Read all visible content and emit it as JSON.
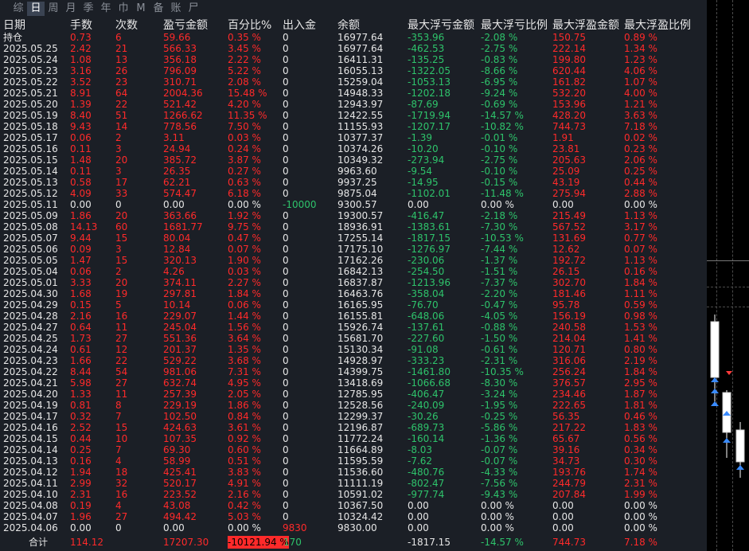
{
  "tabs": [
    "综",
    "日",
    "周",
    "月",
    "季",
    "年",
    "巾",
    "M",
    "备",
    "账",
    "尸"
  ],
  "active_tab": 1,
  "header": [
    "日期",
    "手数",
    "次数",
    "盈亏金额",
    "百分比%",
    "出入金",
    "余额",
    "最大浮亏金额",
    "最大浮亏比例",
    "最大浮盈金额",
    "最大浮盈比例"
  ],
  "rows": [
    [
      "持仓",
      "0.73",
      "6",
      "59.66",
      "0.35 %",
      "0",
      "16977.64",
      "-353.96",
      "-2.08 %",
      "150.75",
      "0.89 %"
    ],
    [
      "2025.05.25",
      "2.42",
      "21",
      "566.33",
      "3.45 %",
      "0",
      "16977.64",
      "-462.53",
      "-2.75 %",
      "222.14",
      "1.34 %"
    ],
    [
      "2025.05.24",
      "1.08",
      "13",
      "356.18",
      "2.22 %",
      "0",
      "16411.31",
      "-135.25",
      "-0.83 %",
      "199.80",
      "1.23 %"
    ],
    [
      "2025.05.23",
      "3.16",
      "26",
      "796.09",
      "5.22 %",
      "0",
      "16055.13",
      "-1322.05",
      "-8.66 %",
      "620.44",
      "4.06 %"
    ],
    [
      "2025.05.22",
      "3.52",
      "23",
      "310.71",
      "2.08 %",
      "0",
      "15259.04",
      "-1053.13",
      "-6.95 %",
      "161.82",
      "1.07 %"
    ],
    [
      "2025.05.21",
      "8.91",
      "64",
      "2004.36",
      "15.48 %",
      "0",
      "14948.33",
      "-1202.18",
      "-9.24 %",
      "532.20",
      "4.00 %"
    ],
    [
      "2025.05.20",
      "1.39",
      "22",
      "521.42",
      "4.20 %",
      "0",
      "12943.97",
      "-87.69",
      "-0.69 %",
      "153.96",
      "1.21 %"
    ],
    [
      "2025.05.19",
      "8.40",
      "51",
      "1266.62",
      "11.35 %",
      "0",
      "12422.55",
      "-1719.94",
      "-14.57 %",
      "428.20",
      "3.63 %"
    ],
    [
      "2025.05.18",
      "9.43",
      "14",
      "778.56",
      "7.50 %",
      "0",
      "11155.93",
      "-1207.17",
      "-10.82 %",
      "744.73",
      "7.18 %"
    ],
    [
      "2025.05.17",
      "0.06",
      "2",
      "3.11",
      "0.03 %",
      "0",
      "10377.37",
      "-1.39",
      "-0.01 %",
      "1.91",
      "0.02 %"
    ],
    [
      "2025.05.16",
      "0.11",
      "3",
      "24.94",
      "0.24 %",
      "0",
      "10374.26",
      "-10.20",
      "-0.10 %",
      "23.81",
      "0.23 %"
    ],
    [
      "2025.05.15",
      "1.48",
      "20",
      "385.72",
      "3.87 %",
      "0",
      "10349.32",
      "-273.94",
      "-2.75 %",
      "205.63",
      "2.06 %"
    ],
    [
      "2025.05.14",
      "0.11",
      "3",
      "26.35",
      "0.27 %",
      "0",
      "9963.60",
      "-9.54",
      "-0.10 %",
      "25.09",
      "0.25 %"
    ],
    [
      "2025.05.13",
      "0.58",
      "17",
      "62.21",
      "0.63 %",
      "0",
      "9937.25",
      "-14.95",
      "-0.15 %",
      "43.19",
      "0.44 %"
    ],
    [
      "2025.05.12",
      "4.09",
      "33",
      "574.47",
      "6.18 %",
      "0",
      "9875.04",
      "-1102.01",
      "-11.48 %",
      "275.94",
      "2.88 %"
    ],
    [
      "2025.05.11",
      "0.00",
      "0",
      "0.00",
      "0.00 %",
      "-10000",
      "9300.57",
      "0.00",
      "0.00 %",
      "0.00",
      "0.00 %"
    ],
    [
      "2025.05.09",
      "1.86",
      "20",
      "363.66",
      "1.92 %",
      "0",
      "19300.57",
      "-416.47",
      "-2.18 %",
      "215.49",
      "1.13 %"
    ],
    [
      "2025.05.08",
      "14.13",
      "60",
      "1681.77",
      "9.75 %",
      "0",
      "18936.91",
      "-1383.61",
      "-7.30 %",
      "567.52",
      "3.17 %"
    ],
    [
      "2025.05.07",
      "9.44",
      "15",
      "80.04",
      "0.47 %",
      "0",
      "17255.14",
      "-1817.15",
      "-10.53 %",
      "131.69",
      "0.77 %"
    ],
    [
      "2025.05.06",
      "0.09",
      "3",
      "12.84",
      "0.07 %",
      "0",
      "17175.10",
      "-1276.97",
      "-7.44 %",
      "12.62",
      "0.07 %"
    ],
    [
      "2025.05.05",
      "1.47",
      "15",
      "320.13",
      "1.90 %",
      "0",
      "17162.26",
      "-230.06",
      "-1.37 %",
      "192.72",
      "1.13 %"
    ],
    [
      "2025.05.04",
      "0.06",
      "2",
      "4.26",
      "0.03 %",
      "0",
      "16842.13",
      "-254.50",
      "-1.51 %",
      "26.15",
      "0.16 %"
    ],
    [
      "2025.05.01",
      "3.33",
      "20",
      "374.11",
      "2.27 %",
      "0",
      "16837.87",
      "-1213.96",
      "-7.37 %",
      "302.70",
      "1.84 %"
    ],
    [
      "2025.04.30",
      "1.68",
      "19",
      "297.81",
      "1.84 %",
      "0",
      "16463.76",
      "-358.04",
      "-2.20 %",
      "181.46",
      "1.11 %"
    ],
    [
      "2025.04.29",
      "0.15",
      "5",
      "10.14",
      "0.06 %",
      "0",
      "16165.95",
      "-76.70",
      "-0.47 %",
      "95.78",
      "0.59 %"
    ],
    [
      "2025.04.28",
      "2.16",
      "16",
      "229.07",
      "1.44 %",
      "0",
      "16155.81",
      "-648.06",
      "-4.05 %",
      "156.19",
      "0.98 %"
    ],
    [
      "2025.04.27",
      "0.64",
      "11",
      "245.04",
      "1.56 %",
      "0",
      "15926.74",
      "-137.61",
      "-0.88 %",
      "240.58",
      "1.53 %"
    ],
    [
      "2025.04.25",
      "1.73",
      "27",
      "551.36",
      "3.64 %",
      "0",
      "15681.70",
      "-227.60",
      "-1.50 %",
      "214.04",
      "1.41 %"
    ],
    [
      "2025.04.24",
      "0.61",
      "12",
      "201.37",
      "1.35 %",
      "0",
      "15130.34",
      "-91.08",
      "-0.61 %",
      "120.71",
      "0.80 %"
    ],
    [
      "2025.04.23",
      "1.66",
      "22",
      "529.22",
      "3.68 %",
      "0",
      "14928.97",
      "-333.23",
      "-2.31 %",
      "316.06",
      "2.19 %"
    ],
    [
      "2025.04.22",
      "8.44",
      "54",
      "981.06",
      "7.31 %",
      "0",
      "14399.75",
      "-1461.80",
      "-10.35 %",
      "256.24",
      "1.84 %"
    ],
    [
      "2025.04.21",
      "5.98",
      "27",
      "632.74",
      "4.95 %",
      "0",
      "13418.69",
      "-1066.68",
      "-8.30 %",
      "376.57",
      "2.95 %"
    ],
    [
      "2025.04.20",
      "1.33",
      "11",
      "257.39",
      "2.05 %",
      "0",
      "12785.95",
      "-406.47",
      "-3.24 %",
      "234.46",
      "1.87 %"
    ],
    [
      "2025.04.19",
      "0.81",
      "8",
      "229.19",
      "1.86 %",
      "0",
      "12528.56",
      "-240.09",
      "-1.95 %",
      "222.65",
      "1.81 %"
    ],
    [
      "2025.04.17",
      "0.32",
      "7",
      "102.50",
      "0.84 %",
      "0",
      "12299.37",
      "-30.26",
      "-0.25 %",
      "56.35",
      "0.46 %"
    ],
    [
      "2025.04.16",
      "2.52",
      "15",
      "424.63",
      "3.61 %",
      "0",
      "12196.87",
      "-689.73",
      "-5.86 %",
      "217.22",
      "1.83 %"
    ],
    [
      "2025.04.15",
      "0.44",
      "10",
      "107.35",
      "0.92 %",
      "0",
      "11772.24",
      "-160.14",
      "-1.36 %",
      "65.67",
      "0.56 %"
    ],
    [
      "2025.04.14",
      "0.25",
      "7",
      "69.30",
      "0.60 %",
      "0",
      "11664.89",
      "-8.03",
      "-0.07 %",
      "39.16",
      "0.34 %"
    ],
    [
      "2025.04.13",
      "0.16",
      "4",
      "58.99",
      "0.51 %",
      "0",
      "11595.59",
      "-7.62",
      "-0.07 %",
      "34.73",
      "0.30 %"
    ],
    [
      "2025.04.12",
      "1.94",
      "18",
      "425.41",
      "3.83 %",
      "0",
      "11536.60",
      "-480.76",
      "-4.33 %",
      "193.76",
      "1.74 %"
    ],
    [
      "2025.04.11",
      "2.99",
      "32",
      "520.17",
      "4.91 %",
      "0",
      "11111.19",
      "-802.47",
      "-7.56 %",
      "244.79",
      "2.31 %"
    ],
    [
      "2025.04.10",
      "2.31",
      "16",
      "223.52",
      "2.16 %",
      "0",
      "10591.02",
      "-977.74",
      "-9.43 %",
      "207.84",
      "1.99 %"
    ],
    [
      "2025.04.08",
      "0.19",
      "4",
      "43.08",
      "0.42 %",
      "0",
      "10367.50",
      "0.00",
      "0.00 %",
      "0.00",
      "0.00 %"
    ],
    [
      "2025.04.07",
      "1.96",
      "27",
      "494.42",
      "5.03 %",
      "0",
      "10324.42",
      "0.00",
      "0.00 %",
      "0.00",
      "0.00 %"
    ],
    [
      "2025.04.06",
      "0.00",
      "0",
      "0.00",
      "0.00 %",
      "9830",
      "9830.00",
      "0.00",
      "0.00 %",
      "0.00",
      "0.00 %"
    ]
  ],
  "total": {
    "label": "合计",
    "lots": "114.12",
    "count": "",
    "profit": "17207.30",
    "percent": "-10121.94 %",
    "deposit": "170",
    "balance": "",
    "max_loss": "-1817.15",
    "max_loss_pct": "-14.57 %",
    "max_profit": "744.73",
    "max_profit_pct": "7.18 %"
  },
  "colors": {
    "panel": "#1b1f26",
    "red": "#ff2a2a",
    "green": "#2ec36b",
    "white": "#e6e6e6"
  }
}
